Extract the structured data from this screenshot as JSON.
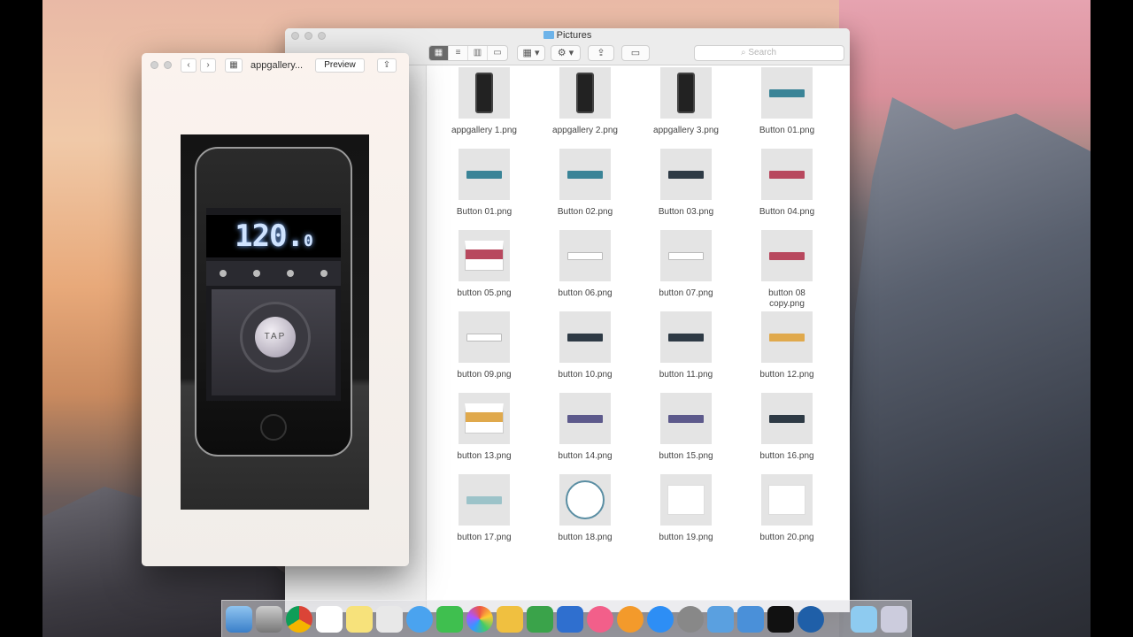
{
  "finder": {
    "title": "Pictures",
    "search_placeholder": "Search",
    "files": [
      "appgallery 1.png",
      "appgallery 2.png",
      "appgallery 3.png",
      "Button 01.png",
      "Button 01.png",
      "Button 02.png",
      "Button 03.png",
      "Button 04.png",
      "button 05.png",
      "button 06.png",
      "button 07.png",
      "button 08\ncopy.png",
      "button 09.png",
      "button 10.png",
      "button 11.png",
      "button 12.png",
      "button 13.png",
      "button 14.png",
      "button 15.png",
      "button 16.png",
      "button 17.png",
      "button 18.png",
      "button 19.png",
      "button 20.png"
    ]
  },
  "preview": {
    "filename": "appgallery...",
    "app_label": "Preview",
    "screen": {
      "display_main": "120.",
      "display_small": "0",
      "tap_label": "TAP"
    }
  },
  "colors": {
    "teal": "#3a8497",
    "dark": "#2e3a45",
    "red": "#b8485e",
    "orange": "#e0a94c",
    "purple": "#5d5a8c"
  }
}
